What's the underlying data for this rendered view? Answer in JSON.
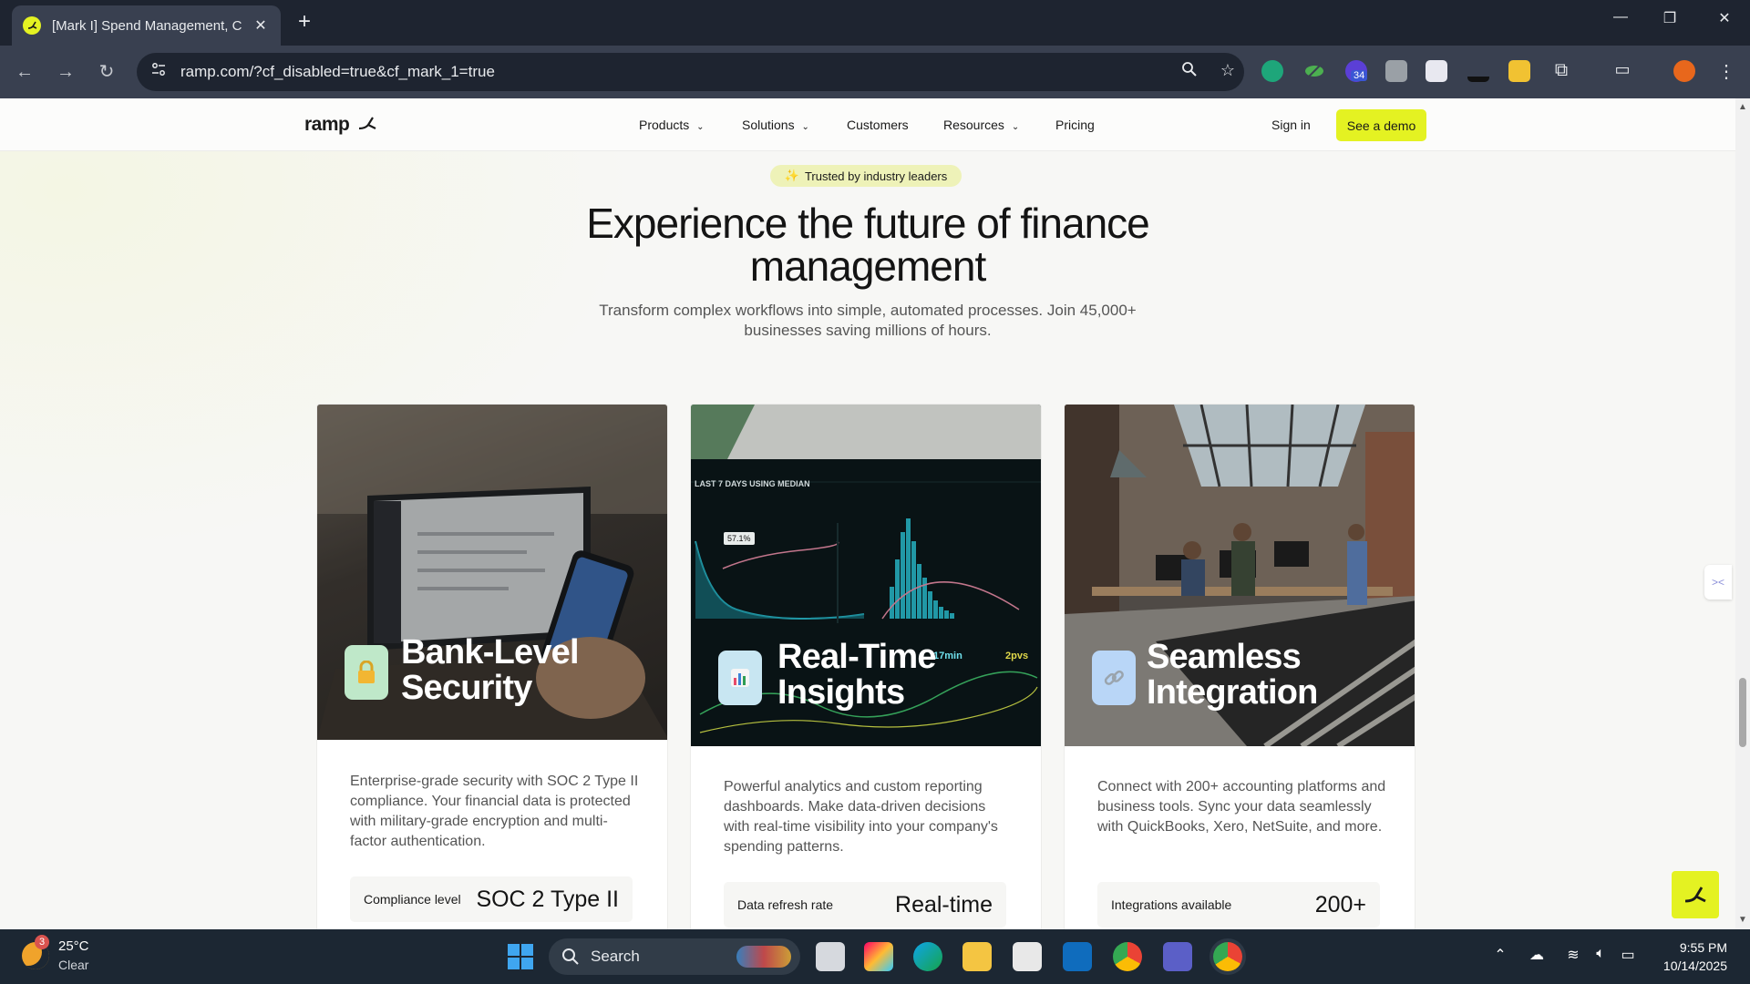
{
  "browser": {
    "tab_title": "[Mark I] Spend Management, C",
    "tab_close": "✕",
    "new_tab": "+",
    "url": "ramp.com/?cf_disabled=true&cf_mark_1=true",
    "window_controls": {
      "minimize": "—",
      "restore": "❐",
      "close": "✕"
    },
    "extension_badge": "34"
  },
  "site": {
    "logo": "ramp",
    "nav": {
      "products": "Products",
      "solutions": "Solutions",
      "customers": "Customers",
      "resources": "Resources",
      "pricing": "Pricing"
    },
    "sign_in": "Sign in",
    "demo": "See a demo"
  },
  "hero": {
    "pill_icon": "✨",
    "pill_text": "Trusted by industry leaders",
    "title_line1": "Experience the future of finance",
    "title_line2": "management",
    "subtitle_line1": "Transform complex workflows into simple, automated processes. Join 45,000+",
    "subtitle_line2": "businesses saving millions of hours."
  },
  "cards": [
    {
      "title_line1": "Bank-Level",
      "title_line2": "Security",
      "icon": "lock-icon",
      "description": "Enterprise-grade security with SOC 2 Type II compliance. Your financial data is protected with military-grade encryption and multi-factor authentication.",
      "stat_label": "Compliance level",
      "stat_value": "SOC 2 Type II"
    },
    {
      "title_line1": "Real-Time",
      "title_line2": "Insights",
      "icon": "bar-chart-icon",
      "description": "Powerful analytics and custom reporting dashboards. Make data-driven decisions with real-time visibility into your company's spending patterns.",
      "stat_label": "Data refresh rate",
      "stat_value": "Real-time",
      "dashboard": {
        "header": "LAST 7 DAYS USING MEDIAN",
        "tooltip": "57.1%",
        "metric1": "17min",
        "metric2": "2pvs"
      }
    },
    {
      "title_line1": "Seamless",
      "title_line2": "Integration",
      "icon": "link-icon",
      "description": "Connect with 200+ accounting platforms and business tools. Sync your data seamlessly with QuickBooks, Xero, NetSuite, and more.",
      "stat_label": "Integrations available",
      "stat_value": "200+"
    }
  ],
  "taskbar": {
    "weather_badge": "3",
    "temperature": "25°C",
    "condition": "Clear",
    "search": "Search",
    "time": "9:55 PM",
    "date": "10/14/2025"
  },
  "colors": {
    "accent": "#e4f222",
    "chrome_dark": "#1e2430",
    "chrome_toolbar": "#394050",
    "taskbar": "#1c2733"
  }
}
